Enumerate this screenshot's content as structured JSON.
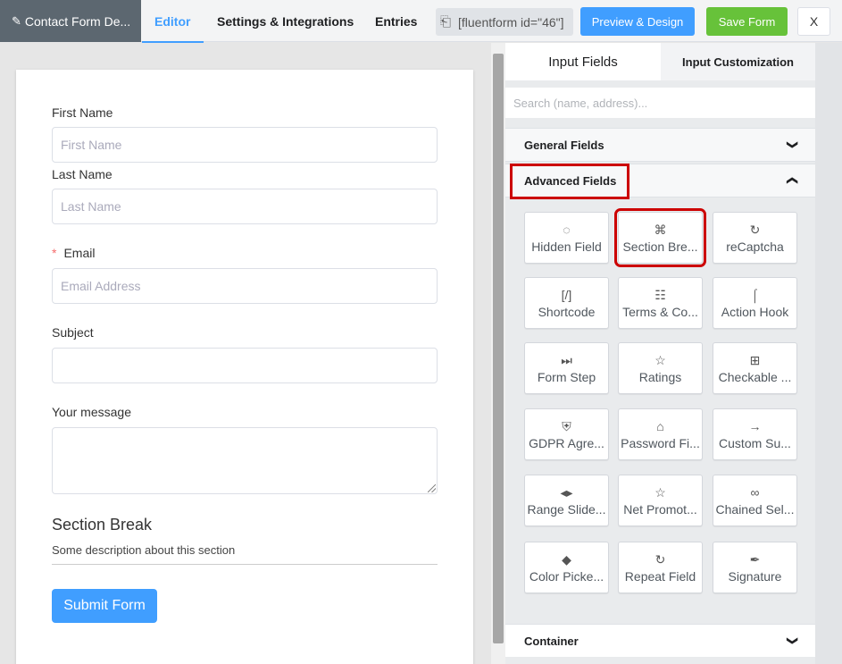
{
  "topbar": {
    "form_title": "Contact Form De...",
    "tabs": [
      "Editor",
      "Settings & Integrations",
      "Entries"
    ],
    "active_tab": "Editor",
    "shortcode": "[fluentform id=\"46\"]",
    "preview_label": "Preview & Design",
    "save_label": "Save Form",
    "close_label": "X",
    "colors": {
      "accent": "#409eff",
      "save": "#67c23a",
      "form_tab": "#5c6770"
    }
  },
  "form": {
    "first_name": {
      "label": "First Name",
      "placeholder": "First Name"
    },
    "last_name": {
      "label": "Last Name",
      "placeholder": "Last Name"
    },
    "email": {
      "required_mark": "*",
      "label": "Email",
      "placeholder": "Email Address"
    },
    "subject": {
      "label": "Subject",
      "value": ""
    },
    "message": {
      "label": "Your message",
      "value": ""
    },
    "section_break": {
      "title": "Section Break",
      "description": "Some description about this section"
    },
    "submit_label": "Submit Form"
  },
  "sidebar": {
    "tabs": [
      "Input Fields",
      "Input Customization"
    ],
    "active_tab": "Input Fields",
    "search_placeholder": "Search (name, address)...",
    "general_fields": "General Fields",
    "advanced_fields": "Advanced Fields",
    "container": "Container",
    "advanced_items": [
      {
        "label": "Hidden Field",
        "icon": "eye-slash-icon",
        "glyph": "◌"
      },
      {
        "label": "Section Bre...",
        "icon": "puzzle-icon",
        "glyph": "⌘",
        "highlighted": true
      },
      {
        "label": "reCaptcha",
        "icon": "recaptcha-icon",
        "glyph": "↻"
      },
      {
        "label": "Shortcode",
        "icon": "shortcode-icon",
        "glyph": "[/]"
      },
      {
        "label": "Terms & Co...",
        "icon": "scroll-icon",
        "glyph": "☷"
      },
      {
        "label": "Action Hook",
        "icon": "hook-icon",
        "glyph": "⌠"
      },
      {
        "label": "Form Step",
        "icon": "fast-forward-icon",
        "glyph": "⏭"
      },
      {
        "label": "Ratings",
        "icon": "star-icon",
        "glyph": "☆"
      },
      {
        "label": "Checkable ...",
        "icon": "checkable-grid-icon",
        "glyph": "⊞"
      },
      {
        "label": "GDPR Agre...",
        "icon": "shield-icon",
        "glyph": "⛨"
      },
      {
        "label": "Password Fi...",
        "icon": "lock-icon",
        "glyph": "⌂"
      },
      {
        "label": "Custom Su...",
        "icon": "arrow-right-icon",
        "glyph": "→"
      },
      {
        "label": "Range Slide...",
        "icon": "range-slider-icon",
        "glyph": "◂▸"
      },
      {
        "label": "Net Promot...",
        "icon": "star-outline-icon",
        "glyph": "☆"
      },
      {
        "label": "Chained Sel...",
        "icon": "link-icon",
        "glyph": "∞"
      },
      {
        "label": "Color Picke...",
        "icon": "drop-icon",
        "glyph": "◆"
      },
      {
        "label": "Repeat Field",
        "icon": "repeat-icon",
        "glyph": "↻"
      },
      {
        "label": "Signature",
        "icon": "feather-icon",
        "glyph": "✒"
      }
    ]
  }
}
